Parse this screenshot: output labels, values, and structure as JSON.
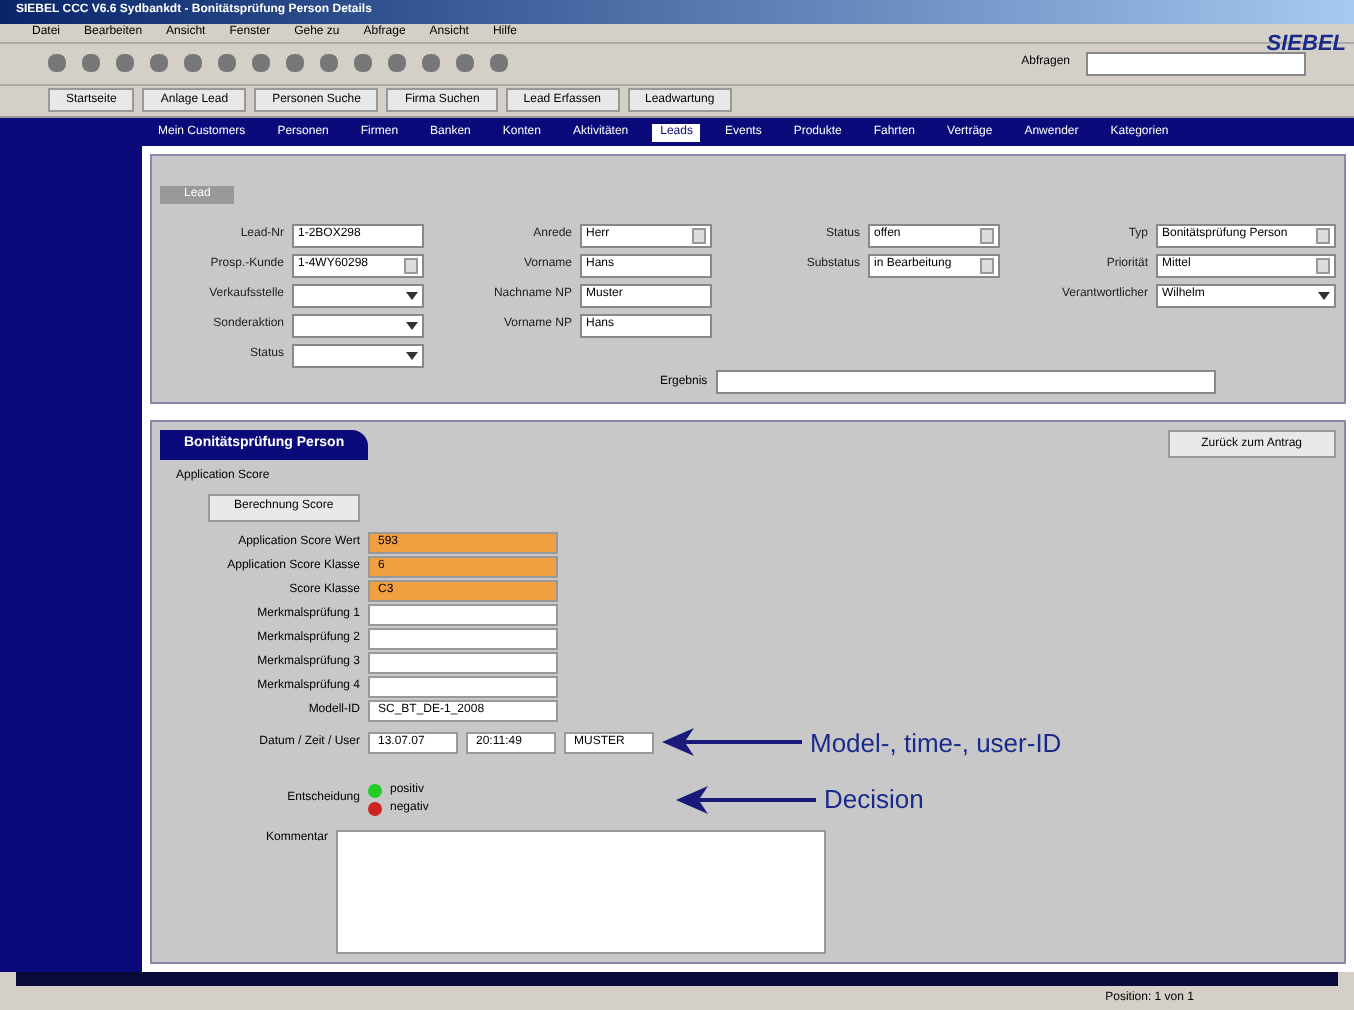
{
  "window": {
    "title": "SIEBEL CCC V6.6 Sydbankdt - Bonitätsprüfung Person Details",
    "logo": "SIEBEL"
  },
  "menu": [
    "Datei",
    "Bearbeiten",
    "Ansicht",
    "Fenster",
    "Gehe zu",
    "Abfrage",
    "Ansicht",
    "Hilfe"
  ],
  "search": {
    "label": "Abfragen"
  },
  "quick_buttons": [
    "Startseite",
    "Anlage Lead",
    "Personen Suche",
    "Firma Suchen",
    "Lead Erfassen",
    "Leadwartung"
  ],
  "nav_tabs": [
    {
      "label": "Mein Customers",
      "selected": false
    },
    {
      "label": "Personen",
      "selected": false
    },
    {
      "label": "Firmen",
      "selected": false
    },
    {
      "label": "Banken",
      "selected": false
    },
    {
      "label": "Konten",
      "selected": false
    },
    {
      "label": "Aktivitäten",
      "selected": false
    },
    {
      "label": "Leads",
      "selected": true
    },
    {
      "label": "Events",
      "selected": false
    },
    {
      "label": "Produkte",
      "selected": false
    },
    {
      "label": "Fahrten",
      "selected": false
    },
    {
      "label": "Verträge",
      "selected": false
    },
    {
      "label": "Anwender",
      "selected": false
    },
    {
      "label": "Kategorien",
      "selected": false
    }
  ],
  "lead": {
    "title": "Lead",
    "columns": [
      [
        {
          "label": "Lead-Nr",
          "value": "1-2BOX298",
          "kind": "text"
        },
        {
          "label": "Prosp.-Kunde",
          "value": "1-4WY60298",
          "kind": "picker"
        },
        {
          "label": "Verkaufsstelle",
          "kind": "dropdown"
        },
        {
          "label": "Sonderaktion",
          "kind": "dropdown"
        },
        {
          "label": "Status",
          "kind": "dropdown"
        }
      ],
      [
        {
          "label": "Anrede",
          "value": "Herr",
          "kind": "picker"
        },
        {
          "label": "Vorname",
          "value": "Hans",
          "kind": "text"
        },
        {
          "label": "Nachname NP",
          "value": "Muster",
          "kind": "text"
        },
        {
          "label": "Vorname NP",
          "value": "Hans",
          "kind": "text"
        }
      ],
      [
        {
          "label": "Status",
          "value": "offen",
          "kind": "picker"
        },
        {
          "label": "Substatus",
          "value": "in Bearbeitung",
          "kind": "picker"
        }
      ],
      [
        {
          "label": "Typ",
          "value": "Bonitätsprüfung Person",
          "kind": "picker"
        },
        {
          "label": "Priorität",
          "value": "Mittel",
          "kind": "picker"
        },
        {
          "label": "Verantwortlicher",
          "value": "Wilhelm",
          "kind": "dropdown"
        }
      ]
    ],
    "result": {
      "label": "Ergebnis"
    }
  },
  "detail": {
    "tab": "Bonitätsprüfung Person",
    "back_button": "Zurück zum Antrag",
    "section": "Application Score",
    "calc_button": "Berechnung Score",
    "fields": [
      {
        "label": "Application Score Wert",
        "value": "593",
        "highlight": true
      },
      {
        "label": "Application Score Klasse",
        "value": "6",
        "highlight": true
      },
      {
        "label": "Score Klasse",
        "value": "C3",
        "highlight": true
      },
      {
        "label": "Merkmalsprüfung 1",
        "highlight": false
      },
      {
        "label": "Merkmalsprüfung 2",
        "highlight": false
      },
      {
        "label": "Merkmalsprüfung 3",
        "highlight": false
      },
      {
        "label": "Merkmalsprüfung 4",
        "highlight": false
      },
      {
        "label": "Modell-ID",
        "value": "SC_BT_DE-1_2008",
        "highlight": false
      }
    ],
    "stamp": {
      "label": "Datum / Zeit / User",
      "values": [
        "13.07.07",
        "20:11:49",
        "MUSTER"
      ]
    },
    "decision": {
      "label": "Entscheidung",
      "options": [
        {
          "label": "positiv",
          "color": "#22cc22"
        },
        {
          "label": "negativ",
          "color": "#cc2222"
        }
      ]
    },
    "comment": {
      "label": "Kommentar"
    }
  },
  "annotations": [
    "Model-, time-, user-ID",
    "Decision"
  ],
  "status_bar": "Position: 1 von 1"
}
